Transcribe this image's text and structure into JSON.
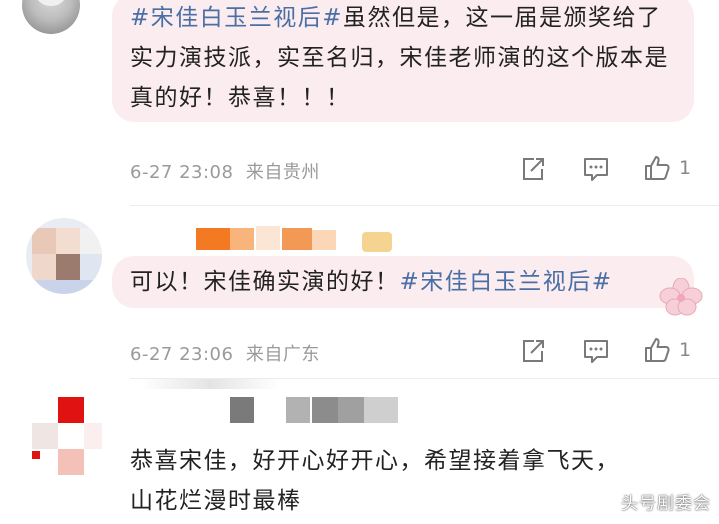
{
  "comments": [
    {
      "hashtag": "#宋佳白玉兰视后#",
      "text": "虽然但是，这一届是颁奖给了实力演技派，实至名归，宋佳老师演的这个版本是真的好！恭喜！！！",
      "time": "6-27 23:08",
      "location": "来自贵州",
      "like_count": "1"
    },
    {
      "text": "可以！宋佳确实演的好！",
      "hashtag": "#宋佳白玉兰视后#",
      "time": "6-27 23:06",
      "location": "来自广东",
      "like_count": "1"
    },
    {
      "text_line1": "恭喜宋佳，好开心好开心，希望接着拿飞天，",
      "text_line2": "山花烂漫时最棒"
    }
  ],
  "icons": [
    "share-icon",
    "comment-icon",
    "thumbs-up-icon"
  ],
  "colors": {
    "bubble": "#fbecef",
    "hashtag": "#4a6fa5",
    "meta": "#9a9a9a"
  },
  "watermark": "头号剧委会"
}
